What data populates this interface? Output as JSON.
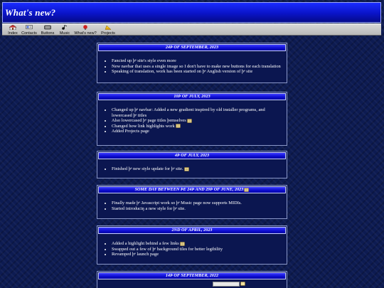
{
  "page": {
    "title": "What's new?"
  },
  "navbar": [
    {
      "label": "Index",
      "icon": "house-icon"
    },
    {
      "label": "Contacts",
      "icon": "contacts-icon"
    },
    {
      "label": "Buttons",
      "icon": "buttons-icon"
    },
    {
      "label": "Music",
      "icon": "music-icon"
    },
    {
      "label": "What's new?",
      "icon": "news-icon"
    },
    {
      "label": "Projects",
      "icon": "projects-icon"
    }
  ],
  "entries": [
    {
      "date": "24Þ OF SEPTEMBER, 2023",
      "items": [
        "Fancied up þᵉ site's style even more",
        "New navbar that uses a single image so I don't have to make new buttons for each translation",
        "Speaking of translation, work has been started on þᵉ Anglish version of þᵉ site"
      ]
    },
    {
      "date": "10Þ OF JULY, 2023",
      "items": [
        "Changed up þᵉ navbar: Added a new gradient inspired by old installer programs, and lowercased þᵉ titles",
        "Also lowercased þᵉ page titles þemselves",
        "Changed how link highlights work",
        "Added Projects page"
      ]
    },
    {
      "date": "4Þ OF JULY, 2023",
      "items": [
        "Finished þᵉ new style update for þᵉ site."
      ]
    },
    {
      "date": "SOME DAY BETWEEN ÞE 24Þ AND 29Þ OF JUNE, 2023",
      "items": [
        "Finally made þᵉ Javascript work so þᵉ Music page now supports MIDIs.",
        "Started introduciŋ a new style for þᵉ site."
      ]
    },
    {
      "date": "2ND OF APRIL, 2023",
      "items": [
        "Added a highlight behind a few links",
        "Swapped out a few of þᵉ background tiles for better legibility",
        "Revamped þᵉ launch page"
      ]
    },
    {
      "date": "14Þ OF SEPTEMBER, 2022",
      "items": []
    }
  ],
  "colors": {
    "background": "#0d1b52",
    "title_bar": "#0a14c8",
    "card_header": "#0b0bd0",
    "navbar": "#c8c8c8"
  }
}
